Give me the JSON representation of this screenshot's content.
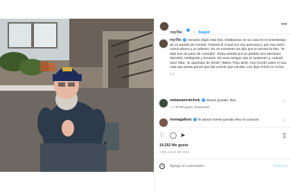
{
  "post": {
    "author": "rey7kc",
    "follow_label": "Seguir",
    "caption_author": "rey7kc",
    "caption_text": "Gerardo eligió esta foto. Estábamos en su casa en el entretiempo de un partido de Central. Todavía el Covid era una amenaza y por esa razón comía afuera y yo adentro. En un momento me dijo que le tomara la foto: \"te dejo une de paso de comedia\". Estoy partido por su partida. Era talentoso, divertido, inteligente y honesto. De esos amigos que te sostienen y, cuando hace falta, \"te apuñalan de frente\" (Mario Trejo dixit). Hoy escribí sobre el una nota que jamás pensé que iba a tener que escribir. Les dejo el link en mi bio",
    "caption_time": "1 d",
    "comments": [
      {
        "user": "sebawainraichok",
        "text": "Abrazo grande, Rey",
        "time": "1 d",
        "likes": "90 Me gusta",
        "reply": "Responder"
      },
      {
        "user": "monagallosi",
        "text": "Te abrazo fuerte querido Rey mi corazón",
        "time": ""
      }
    ],
    "likes": "19,252 Me gusta",
    "date": "1 DE JULIO DE 2022",
    "comment_placeholder": "Agrega un comentario...",
    "publish_label": "Publicar"
  },
  "icons": {
    "more": "more-horizontal-icon",
    "heart": "heart-icon",
    "comment": "comment-icon",
    "share": "share-icon",
    "save": "bookmark-icon",
    "emoji": "emoji-icon",
    "verified": "verified-badge-icon"
  },
  "colors": {
    "accent": "#0095f6",
    "verified": "#3897f0",
    "muted": "#8e8e8e"
  }
}
